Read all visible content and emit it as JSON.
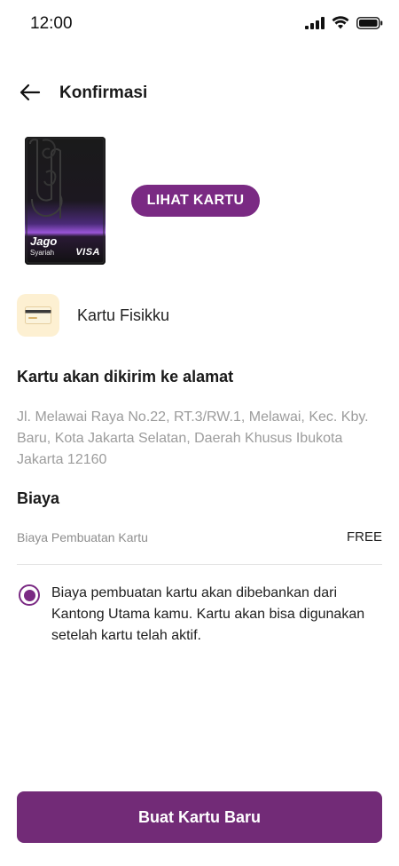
{
  "status_bar": {
    "time": "12:00"
  },
  "header": {
    "title": "Konfirmasi"
  },
  "card": {
    "brand": "Jago",
    "sub": "Syariah",
    "network": "VISA"
  },
  "view_card_button": "LIHAT KARTU",
  "card_type": {
    "label": "Kartu Fisikku"
  },
  "address_section": {
    "title": "Kartu akan dikirim ke alamat",
    "address": "Jl. Melawai Raya No.22, RT.3/RW.1, Melawai, Kec. Kby. Baru, Kota Jakarta Selatan, Daerah Khusus Ibukota Jakarta 12160"
  },
  "fee_section": {
    "title": "Biaya",
    "label": "Biaya Pembuatan Kartu",
    "value": "FREE"
  },
  "notice": {
    "text": "Biaya pembuatan kartu akan dibebankan dari Kantong Utama kamu. Kartu akan bisa digunakan setelah kartu telah aktif."
  },
  "primary_button": "Buat Kartu Baru",
  "colors": {
    "accent": "#7a2a83",
    "button": "#722b77",
    "card_icon_bg": "#fdf0d2"
  }
}
